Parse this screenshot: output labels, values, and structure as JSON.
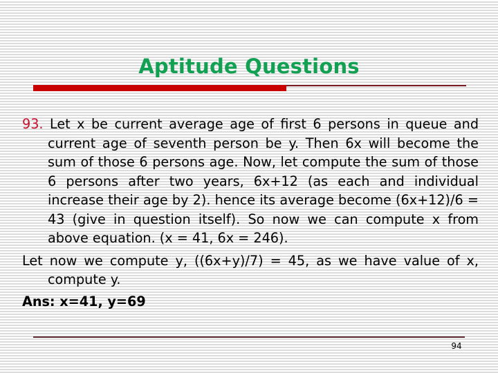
{
  "slide": {
    "title": "Aptitude Questions",
    "page_number": "94",
    "colors": {
      "title": "#12a052",
      "accent_bar": "#c80000",
      "question_number": "#c8102e"
    }
  },
  "content": {
    "question_number": "93.",
    "paragraph_1": " Let x be current average age of first 6 persons in queue and current age of seventh person be y. Then 6x will become the sum of those 6 persons age. Now, let compute the sum of those 6 persons after two years, 6x+12 (as each and individual increase their age by 2). hence its average become (6x+12)/6 = 43 (give in question itself). So now we can compute x from above equation. (x = 41, 6x = 246).",
    "paragraph_2": "Let now we compute y, ((6x+y)/7) = 45, as we have value of x, compute y.",
    "answer": "Ans: x=41, y=69"
  }
}
